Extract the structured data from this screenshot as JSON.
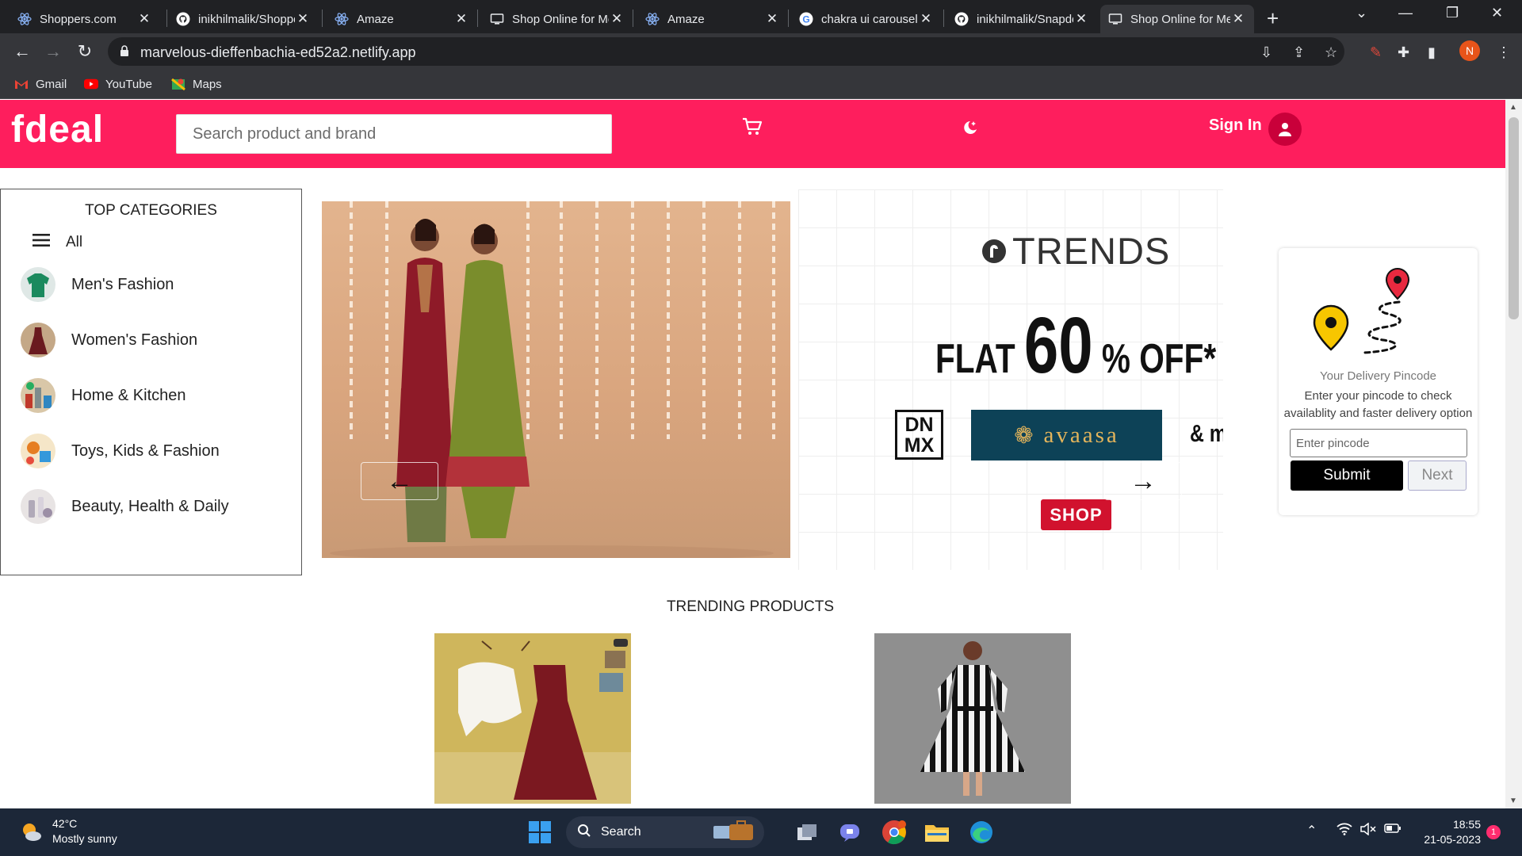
{
  "browser": {
    "tabs": [
      {
        "title": "Shoppers.com",
        "icon": "react-icon"
      },
      {
        "title": "inikhilmalik/Shoppers",
        "icon": "github-icon"
      },
      {
        "title": "Amaze",
        "icon": "react-icon"
      },
      {
        "title": "Shop Online for Men",
        "icon": "monitor-icon"
      },
      {
        "title": "Amaze",
        "icon": "react-icon"
      },
      {
        "title": "chakra ui carousel",
        "icon": "google-icon"
      },
      {
        "title": "inikhilmalik/Snapdeal",
        "icon": "github-icon"
      },
      {
        "title": "Shop Online for Men",
        "icon": "monitor-icon",
        "active": true
      }
    ],
    "url": "marvelous-dieffenbachia-ed52a2.netlify.app",
    "profile_initial": "N",
    "bookmarks": [
      {
        "label": "Gmail",
        "icon": "gmail-icon"
      },
      {
        "label": "YouTube",
        "icon": "youtube-icon"
      },
      {
        "label": "Maps",
        "icon": "maps-icon"
      }
    ]
  },
  "site": {
    "logo": "fdeal",
    "search_placeholder": "Search product and brand",
    "signin_label": "Sign In",
    "brand_color": "#fe1e5d"
  },
  "categories": {
    "title": "TOP CATEGORIES",
    "all_label": "All",
    "items": [
      {
        "label": "Men's Fashion"
      },
      {
        "label": "Women's Fashion"
      },
      {
        "label": "Home & Kitchen"
      },
      {
        "label": "Toys, Kids & Fashion"
      },
      {
        "label": "Beauty, Health & Daily"
      }
    ]
  },
  "carousel": {
    "ad": {
      "brand": "TRENDS",
      "offer_prefix": "FLAT",
      "offer_value": "60",
      "offer_suffix": "% OFF*",
      "partner_1": "DN MX",
      "partner_2": "avaasa",
      "more": "& m",
      "cta": "SHOP"
    }
  },
  "pincode": {
    "title": "Your Delivery Pincode",
    "description": "Enter your pincode to check availablity and faster delivery option",
    "placeholder": "Enter pincode",
    "submit_label": "Submit",
    "next_label": "Next"
  },
  "trending": {
    "title": "TRENDING PRODUCTS"
  },
  "taskbar": {
    "temperature": "42°C",
    "weather": "Mostly sunny",
    "search_label": "Search",
    "time": "18:55",
    "date": "21-05-2023",
    "notifications": "1"
  }
}
